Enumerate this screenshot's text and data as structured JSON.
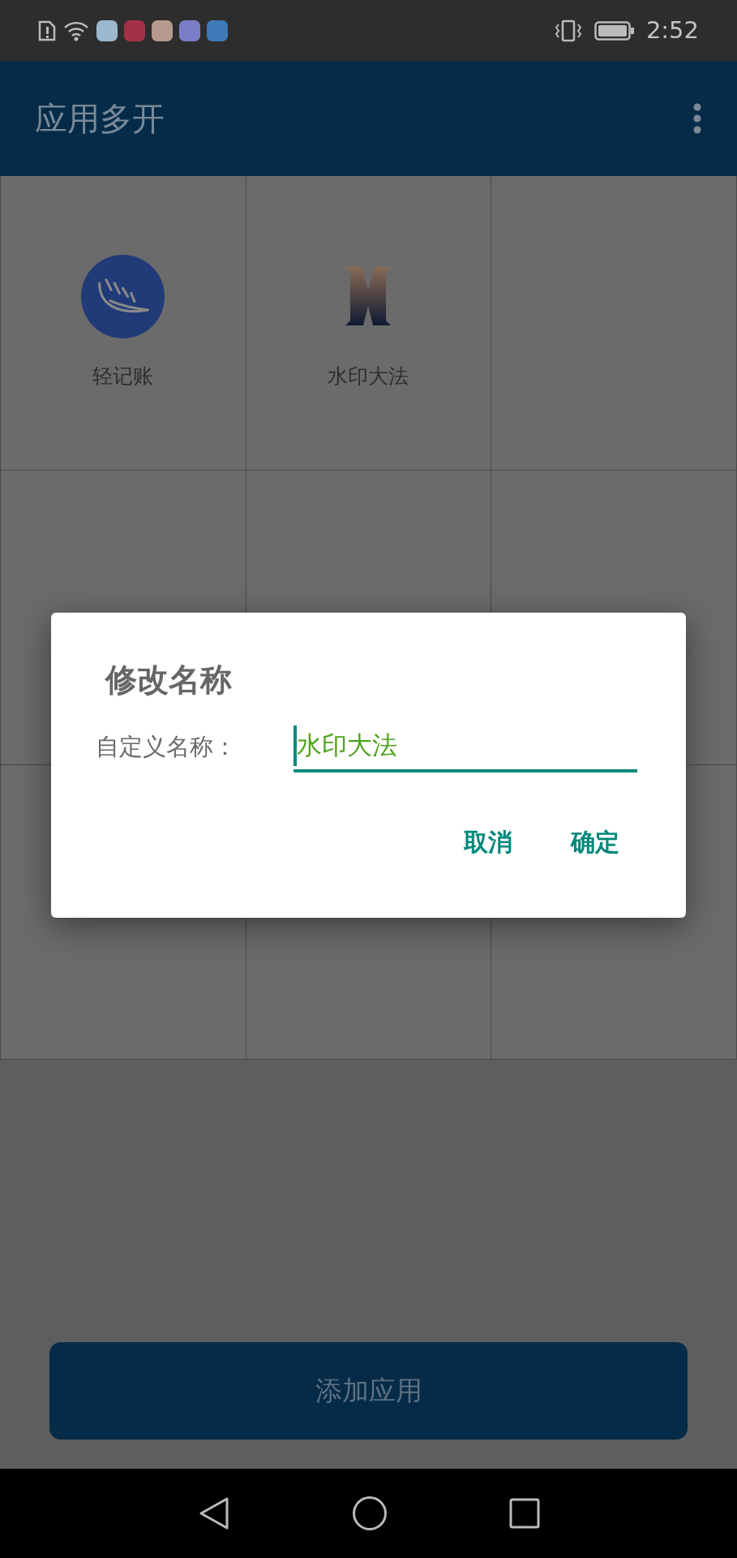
{
  "status_bar": {
    "time": "2:52"
  },
  "app_bar": {
    "title": "应用多开"
  },
  "apps": [
    {
      "label": "轻记账",
      "kind": "feather"
    },
    {
      "label": "水印大法",
      "kind": "emblem"
    }
  ],
  "dialog": {
    "title": "修改名称",
    "field_label": "自定义名称：",
    "field_value": "水印大法",
    "buttons": [
      "取消",
      "确定"
    ]
  },
  "add_button": {
    "label": "添加应用"
  }
}
